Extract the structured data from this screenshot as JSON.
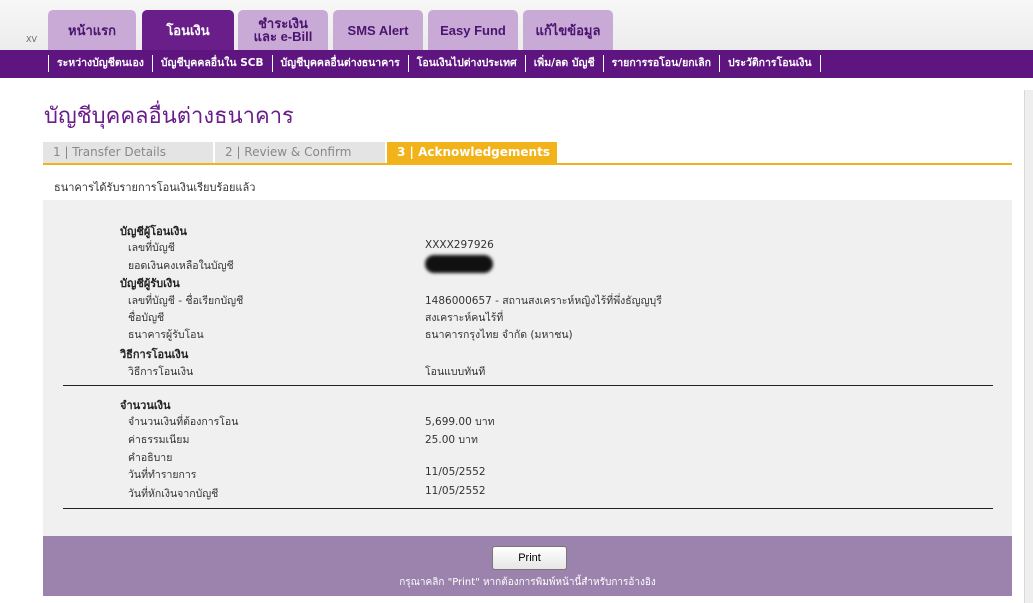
{
  "top": {
    "version": "XV",
    "tabs": [
      {
        "label": "หน้าแรก"
      },
      {
        "label": "โอนเงิน"
      },
      {
        "label": "ชำระเงิน\nและ e-Bill"
      },
      {
        "label": "SMS Alert"
      },
      {
        "label": "Easy Fund"
      },
      {
        "label": "แก้ไขข้อมูล"
      }
    ]
  },
  "subnav": {
    "items": [
      "ระหว่างบัญชีตนเอง",
      "บัญชีบุคคลอื่นใน SCB",
      "บัญชีบุคคลอื่นต่างธนาคาร",
      "โอนเงินไปต่างประเทศ",
      "เพิ่ม/ลด บัญชี",
      "รายการรอโอน/ยกเลิก",
      "ประวัติการโอนเงิน"
    ]
  },
  "page": {
    "title": "บัญชีบุคคลอื่นต่างธนาคาร",
    "steps": [
      "1 | Transfer Details",
      "2 | Review & Confirm",
      "3 | Acknowledgements"
    ],
    "received_msg": "ธนาคารได้รับรายการโอนเงินเรียบร้อยแล้ว"
  },
  "details": {
    "from_head": "บัญชีผู้โอนเงิน",
    "from_acct_label": "เลขที่บัญชี",
    "from_acct_value": "XXXX297926",
    "balance_label": "ยอดเงินคงเหลือในบัญชี",
    "to_head": "บัญชีผู้รับเงิน",
    "to_acct_label": "เลขที่บัญชี - ชื่อเรียกบัญชี",
    "to_acct_value": "1486000657 - สถานสงเคราะห์หญิงไร้ที่พึ่งธัญญบุรี",
    "to_name_label": "ชื่อบัญชี",
    "to_name_value": "สงเคราะห์คนไร้ที่",
    "to_bank_label": "ธนาคารผู้รับโอน",
    "to_bank_value": "ธนาคารกรุงไทย จำกัด (มหาชน)",
    "method_head": "วิธีการโอนเงิน",
    "method_label": "วิธีการโอนเงิน",
    "method_value": "โอนแบบทันที",
    "amount_head": "จำนวนเงิน",
    "amount_label": "จำนวนเงินที่ต้องการโอน",
    "amount_value": "5,699.00 บาท",
    "fee_label": "ค่าธรรมเนียม",
    "fee_value": "25.00  บาท",
    "desc_label": "คำอธิบาย",
    "txn_date_label": "วันที่ทำรายการ",
    "txn_date_value": "11/05/2552",
    "debit_date_label": "วันที่หักเงินจากบัญชี",
    "debit_date_value": "11/05/2552"
  },
  "footer": {
    "print_label": "Print",
    "note": "กรุณาคลิก \"Print\" หากต้องการพิมพ์หน้านี้สำหรับการอ้างอิง"
  }
}
